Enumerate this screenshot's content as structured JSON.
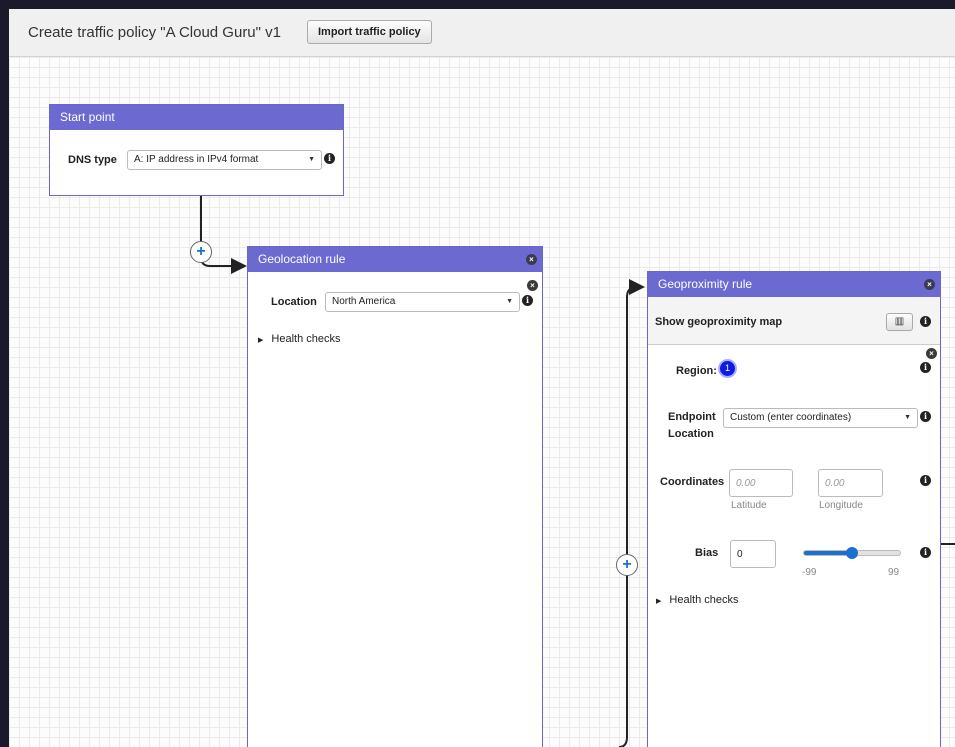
{
  "header": {
    "title": "Create traffic policy \"A Cloud Guru\" v1",
    "import_label": "Import traffic policy"
  },
  "start_point": {
    "title": "Start point",
    "dns_type_label": "DNS type",
    "dns_type_value": "A: IP address in IPv4 format"
  },
  "geolocation_rule": {
    "title": "Geolocation rule",
    "location_label": "Location",
    "location_value": "North America",
    "health_checks_label": "Health checks"
  },
  "geoproximity_rule": {
    "title": "Geoproximity rule",
    "show_map_label": "Show geoproximity map",
    "region_label": "Region:",
    "region_number": "1",
    "endpoint_label_line1": "Endpoint",
    "endpoint_label_line2": "Location",
    "endpoint_value": "Custom (enter coordinates)",
    "coordinates_label": "Coordinates",
    "latitude_placeholder": "0.00",
    "longitude_placeholder": "0.00",
    "latitude_label": "Latitude",
    "longitude_label": "Longitude",
    "bias_label": "Bias",
    "bias_value": "0",
    "slider_min": "-99",
    "slider_max": "99",
    "slider_value": 0,
    "health_checks_label": "Health checks"
  },
  "icons": {
    "add": "plus-circle-icon",
    "close": "close-circle-icon",
    "info": "info-icon",
    "map": "map-icon",
    "caret": "caret-down-icon"
  },
  "colors": {
    "panel_header": "#6c69d1",
    "accent": "#1b6fd1",
    "region_badge": "#0a1de0"
  }
}
